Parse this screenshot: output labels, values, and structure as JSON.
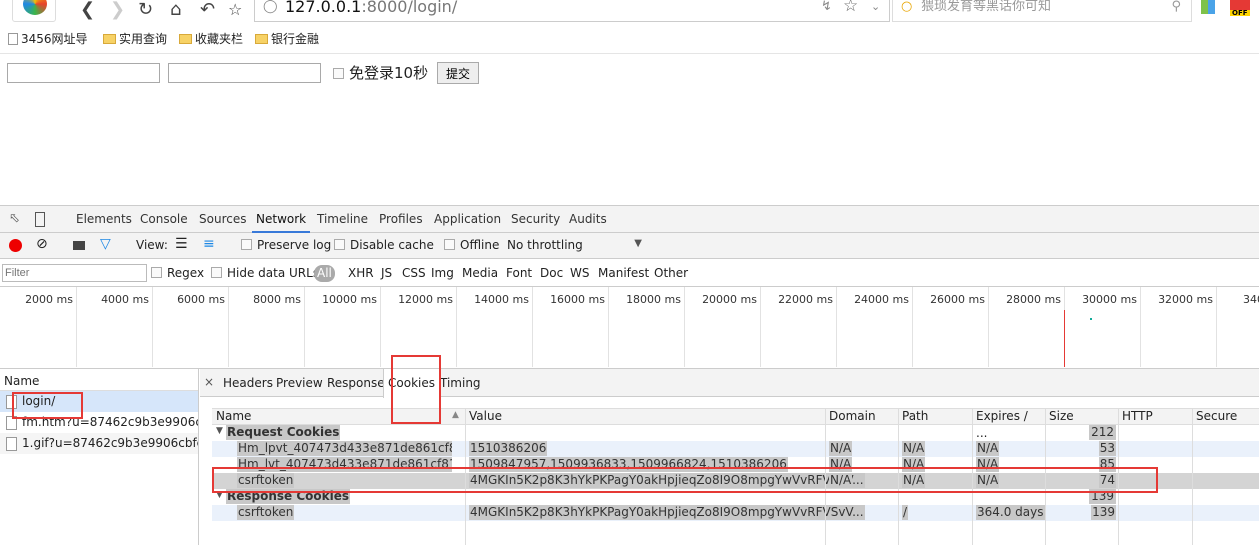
{
  "browser": {
    "url_host": "127.0.0.1",
    "url_rest": ":8000/login/",
    "search_placeholder": "猥琐发育等黑话你可知",
    "ext_badge": "OFF",
    "bookmarks": [
      "3456网址导",
      "实用查询",
      "收藏夹栏",
      "银行金融"
    ]
  },
  "page": {
    "checkbox_label": "免登录10秒",
    "submit_label": "提交",
    "username_value": "",
    "password_value": ""
  },
  "devtools": {
    "tabs": [
      "Elements",
      "Console",
      "Sources",
      "Network",
      "Timeline",
      "Profiles",
      "Application",
      "Security",
      "Audits"
    ],
    "active_tab": "Network",
    "toolbar": {
      "view_label": "View:",
      "preserve_log": "Preserve log",
      "disable_cache": "Disable cache",
      "offline": "Offline",
      "throttling": "No throttling"
    },
    "filter": {
      "placeholder": "Filter",
      "regex": "Regex",
      "hide_data_urls": "Hide data URLs",
      "types": [
        "All",
        "XHR",
        "JS",
        "CSS",
        "Img",
        "Media",
        "Font",
        "Doc",
        "WS",
        "Manifest",
        "Other"
      ]
    },
    "timeline_ticks": [
      "2000 ms",
      "4000 ms",
      "6000 ms",
      "8000 ms",
      "10000 ms",
      "12000 ms",
      "14000 ms",
      "16000 ms",
      "18000 ms",
      "20000 ms",
      "22000 ms",
      "24000 ms",
      "26000 ms",
      "28000 ms",
      "30000 ms",
      "32000 ms",
      "340"
    ],
    "requests": {
      "header": "Name",
      "items": [
        "login/",
        "fm.htm?u=87462c9b3e9906cbf...",
        "1.gif?u=87462c9b3e9906cbfe8..."
      ]
    },
    "detail_tabs": [
      "Headers",
      "Preview",
      "Response",
      "Cookies",
      "Timing"
    ],
    "active_detail_tab": "Cookies",
    "cookies": {
      "columns": [
        "Name",
        "Value",
        "Domain",
        "Path",
        "Expires / ...",
        "Size",
        "HTTP",
        "Secure"
      ],
      "groups": [
        {
          "label": "Request Cookies",
          "size": "212",
          "rows": [
            {
              "name": "Hm_lpvt_407473d433e871de861cf818aa1...",
              "value": "1510386206",
              "domain": "N/A",
              "path": "N/A",
              "expires": "N/A",
              "size": "53"
            },
            {
              "name": "Hm_lvt_407473d433e871de861cf818aa14",
              "value": "1509847957,1509936833,1509966824,1510386206",
              "domain": "N/A",
              "path": "N/A",
              "expires": "N/A",
              "size": "85"
            },
            {
              "name": "csrftoken",
              "value": "4MGKIn5K2p8K3hYkPKPagY0akHpjieqZo8I9O8mpgYwVvRFVSvV...",
              "domain": "N/A",
              "path": "N/A",
              "expires": "N/A",
              "size": "74"
            }
          ]
        },
        {
          "label": "Response Cookies",
          "size": "139",
          "rows": [
            {
              "name": "csrftoken",
              "value": "4MGKIn5K2p8K3hYkPKPagY0akHpjieqZo8I9O8mpgYwVvRFVSvV...",
              "domain": "",
              "path": "/",
              "expires": "364.0 days",
              "size": "139"
            }
          ]
        }
      ]
    }
  }
}
